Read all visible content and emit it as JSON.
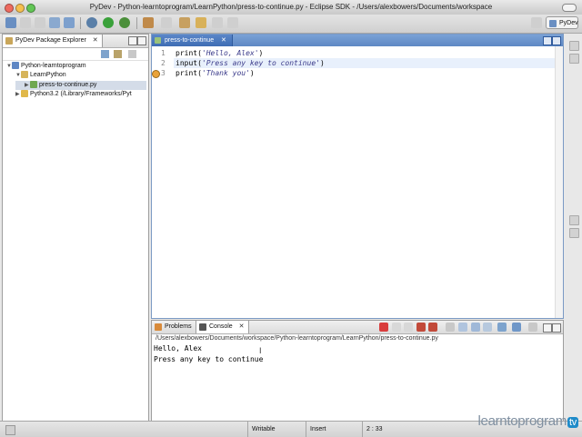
{
  "window": {
    "title": "PyDev - Python-learntoprogram/LearnPython/press-to-continue.py - Eclipse SDK - /Users/alexbowers/Documents/workspace"
  },
  "toolbar": {
    "perspective_label": "PyDev"
  },
  "explorer": {
    "tab_label": "PyDev Package Explorer",
    "tree": [
      {
        "label": "Python-learntoprogram",
        "icon": "project-icon"
      },
      {
        "label": "LearnPython",
        "icon": "package-icon"
      },
      {
        "label": "press-to-continue.py",
        "icon": "python-file-icon",
        "selected": true
      },
      {
        "label": "Python3.2  (/Library/Frameworks/Pyt",
        "icon": "python-interpreter-icon"
      }
    ]
  },
  "editor": {
    "tab_label": "press-to-continue",
    "lines": [
      {
        "num": "1",
        "fn": "print(",
        "str": "'Hello, Alex'",
        "end": ")"
      },
      {
        "num": "2",
        "fn": "input(",
        "str": "'Press any key to continue'",
        "end": ")"
      },
      {
        "num": "3",
        "fn": "print(",
        "str": "'Thank you'",
        "end": ")"
      }
    ]
  },
  "console": {
    "tabs": [
      "Problems",
      "Console"
    ],
    "path": "/Users/alexbowers/Documents/workspace/Python-learntoprogram/LearnPython/press-to-continue.py",
    "output": [
      "Hello, Alex",
      "Press any key to continue"
    ]
  },
  "status": {
    "writable": "Writable",
    "insert": "Insert",
    "position": "2 : 33"
  },
  "watermark": {
    "logo_text": "learntoprogram",
    "logo_suffix": "tv"
  }
}
